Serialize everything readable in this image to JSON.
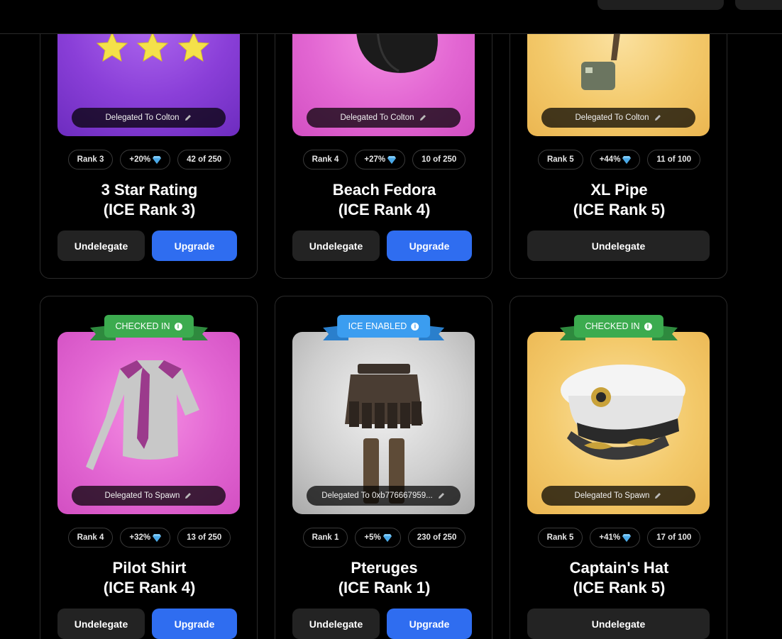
{
  "cards": [
    {
      "delegated_label": "Delegated To Colton",
      "rank_chip": "Rank 3",
      "bonus_chip": "+20%",
      "supply_chip": "42 of 250",
      "title_line1": "3 Star Rating",
      "title_line2": "(ICE Rank 3)",
      "undelegate_label": "Undelegate",
      "upgrade_label": "Upgrade"
    },
    {
      "delegated_label": "Delegated To Colton",
      "rank_chip": "Rank 4",
      "bonus_chip": "+27%",
      "supply_chip": "10 of 250",
      "title_line1": "Beach Fedora",
      "title_line2": "(ICE Rank 4)",
      "undelegate_label": "Undelegate",
      "upgrade_label": "Upgrade"
    },
    {
      "delegated_label": "Delegated To Colton",
      "rank_chip": "Rank 5",
      "bonus_chip": "+44%",
      "supply_chip": "11 of 100",
      "title_line1": "XL Pipe",
      "title_line2": "(ICE Rank 5)",
      "undelegate_label": "Undelegate"
    },
    {
      "ribbon_label": "CHECKED IN",
      "delegated_label": "Delegated To Spawn",
      "rank_chip": "Rank 4",
      "bonus_chip": "+32%",
      "supply_chip": "13 of 250",
      "title_line1": "Pilot Shirt",
      "title_line2": "(ICE Rank 4)",
      "undelegate_label": "Undelegate",
      "upgrade_label": "Upgrade"
    },
    {
      "ribbon_label": "ICE ENABLED",
      "delegated_label": "Delegated To 0xb776667959...",
      "rank_chip": "Rank 1",
      "bonus_chip": "+5%",
      "supply_chip": "230 of 250",
      "title_line1": "Pteruges",
      "title_line2": "(ICE Rank 1)",
      "undelegate_label": "Undelegate",
      "upgrade_label": "Upgrade"
    },
    {
      "ribbon_label": "CHECKED IN",
      "delegated_label": "Delegated To Spawn",
      "rank_chip": "Rank 5",
      "bonus_chip": "+41%",
      "supply_chip": "17 of 100",
      "title_line1": "Captain's Hat",
      "title_line2": "(ICE Rank 5)",
      "undelegate_label": "Undelegate"
    }
  ],
  "colors": {
    "upgrade": "#2f6df0",
    "checked_in": "#3cab4f",
    "ice_enabled": "#3b9df0"
  },
  "icons": [
    "pencil-icon",
    "diamond-icon",
    "info-icon"
  ]
}
